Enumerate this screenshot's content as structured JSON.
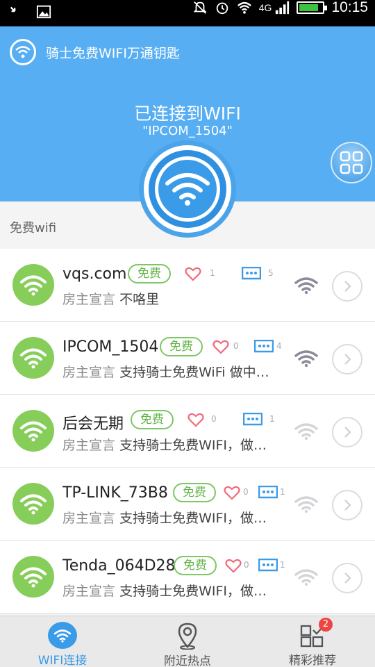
{
  "status_bar": {
    "time": "10:15",
    "network": "4G",
    "icons": [
      "phone-missed-icon",
      "image-icon",
      "mute-icon",
      "alarm-icon",
      "wifi-icon",
      "signal-icon",
      "battery-icon"
    ],
    "battery_fill": 0.85
  },
  "header": {
    "app_title": "骑士免费WIFI万通钥匙",
    "connection_status": "已连接到WIFI",
    "connected_ssid": "\"IPCOM_1504\"",
    "accent_color": "#57aef2"
  },
  "section": {
    "label": "免费wifi"
  },
  "networks": [
    {
      "name": "vqs.com",
      "badge": "免费",
      "likes": "1",
      "comments": "5",
      "desc_label": "房主宣言",
      "desc_text": "不咯里",
      "signal": "strong"
    },
    {
      "name": "IPCOM_1504",
      "badge": "免费",
      "likes": "0",
      "comments": "4",
      "desc_label": "房主宣言",
      "desc_text": "支持骑士免费WiFi 做中…",
      "signal": "strong"
    },
    {
      "name": "后会无期",
      "badge": "免费",
      "likes": "0",
      "comments": "1",
      "desc_label": "房主宣言",
      "desc_text": "支持骑士免费WIFI，做…",
      "signal": "weak"
    },
    {
      "name": "TP-LINK_73B8",
      "badge": "免费",
      "likes": "0",
      "comments": "1",
      "desc_label": "房主宣言",
      "desc_text": "支持骑士免费WIFI，做…",
      "signal": "weak"
    },
    {
      "name": "Tenda_064D28",
      "badge": "免费",
      "likes": "0",
      "comments": "1",
      "desc_label": "房主宣言",
      "desc_text": "支持骑士免费WIFI，做…",
      "signal": "weak"
    }
  ],
  "bottom_nav": {
    "items": [
      {
        "label": "WIFI连接",
        "icon": "wifi-icon",
        "active": true
      },
      {
        "label": "附近热点",
        "icon": "location-pin-icon",
        "active": false
      },
      {
        "label": "精彩推荐",
        "icon": "apps-icon",
        "active": false,
        "badge": "2"
      }
    ]
  }
}
